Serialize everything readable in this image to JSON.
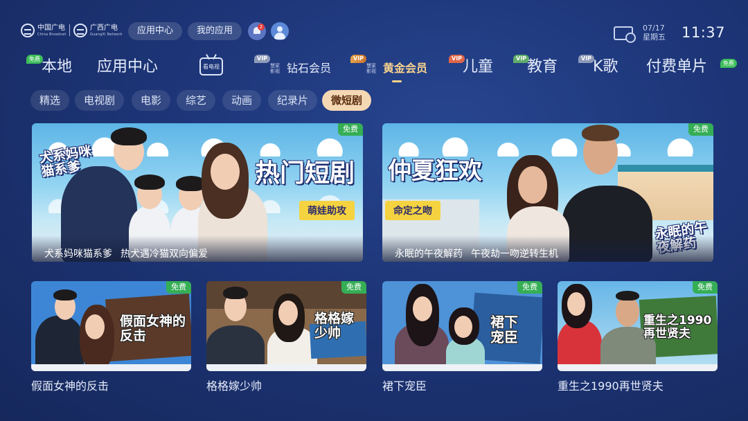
{
  "header": {
    "logo_cbn": {
      "title": "中国广电",
      "subtitle": "China Broadnet"
    },
    "logo_gx": {
      "title": "广西广电",
      "subtitle": "GuangXi Network"
    },
    "buttons": [
      "应用中心",
      "我的应用"
    ],
    "notification_count": "2",
    "date": "07/17",
    "weekday": "星期五",
    "time": "11:37"
  },
  "nav": {
    "items": [
      {
        "label": "本地",
        "tag": "免费"
      },
      {
        "label": "应用中心"
      },
      {
        "label": "看电视",
        "kind": "logo"
      },
      {
        "label": "钻石会员",
        "tag": "VIP",
        "brand": "慧家影视"
      },
      {
        "label": "黄金会员",
        "tag": "VIP",
        "brand": "慧家影视",
        "active": true
      },
      {
        "label": "儿童",
        "tag": "VIP"
      },
      {
        "label": "教育",
        "tag": "VIP"
      },
      {
        "label": "K歌",
        "tag": "VIP"
      },
      {
        "label": "付费单片"
      },
      {
        "tag": "免费"
      }
    ]
  },
  "subtabs": {
    "items": [
      "精选",
      "电视剧",
      "电影",
      "综艺",
      "动画",
      "纪录片",
      "微短剧"
    ],
    "active": "微短剧"
  },
  "free_label": "免费",
  "featured": [
    {
      "poster_title": "热门短剧",
      "poster_badge": "犬系妈咪猫系爹",
      "tag": "萌娃助攻",
      "title": "犬系妈咪猫系爹",
      "desc": "热犬遇冷猫双向偏爱"
    },
    {
      "poster_title": "仲夏狂欢",
      "poster_badge": "永眠的午夜解药",
      "tag": "命定之吻",
      "title": "永眠的午夜解药",
      "desc": "午夜劫一吻逆转生机"
    }
  ],
  "shorts": [
    {
      "title": "假面女神的反击",
      "poster_text": "假面女神的反击"
    },
    {
      "title": "格格嫁少帅",
      "poster_text": "格格嫁少帅"
    },
    {
      "title": "裙下宠臣",
      "poster_text": "裙下宠臣"
    },
    {
      "title": "重生之1990再世贤夫",
      "poster_text": "重生之1990再世贤夫"
    }
  ],
  "colors": {
    "background": "#1d3577",
    "active_nav": "#f7d38d",
    "active_tab": "#f4d8b4",
    "free_badge": "#35ae55",
    "poster_yellow": "#f5d340"
  }
}
